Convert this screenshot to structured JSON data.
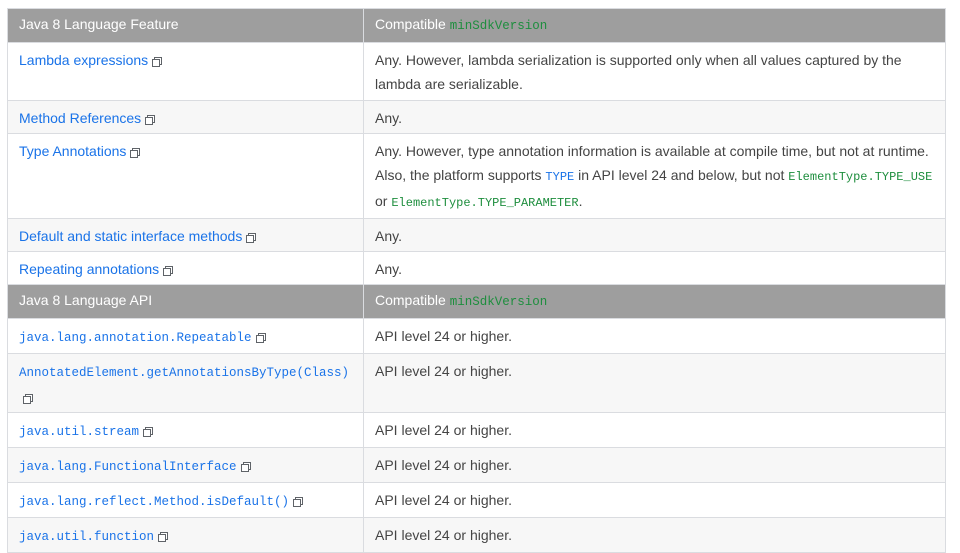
{
  "feature_table": {
    "header": {
      "col1": "Java 8 Language Feature",
      "col2_text": "Compatible ",
      "col2_code": "minSdkVersion"
    },
    "rows": [
      {
        "feature": "Lambda expressions",
        "desc": "Any. However, lambda serialization is supported only when all values captured by the lambda are serializable."
      },
      {
        "feature": "Method References",
        "desc": "Any."
      },
      {
        "feature": "Type Annotations",
        "desc_a": "Any. However, type annotation information is available at compile time, but not at runtime. Also, the platform supports ",
        "desc_code1": "TYPE",
        "desc_b": " in API level 24 and below, but not ",
        "desc_code2": "ElementType.TYPE_USE",
        "desc_c": " or ",
        "desc_code3": "ElementType.TYPE_PARAMETER",
        "desc_d": "."
      },
      {
        "feature": "Default and static interface methods",
        "desc": "Any."
      },
      {
        "feature": "Repeating annotations",
        "desc": "Any."
      }
    ]
  },
  "api_table": {
    "header": {
      "col1": "Java 8 Language API",
      "col2_text": "Compatible ",
      "col2_code": "minSdkVersion"
    },
    "rows": [
      {
        "api": "java.lang.annotation.Repeatable",
        "desc": "API level 24 or higher."
      },
      {
        "api": "AnnotatedElement.getAnnotationsByType(Class)",
        "desc": "API level 24 or higher."
      },
      {
        "api": "java.util.stream",
        "desc": "API level 24 or higher."
      },
      {
        "api": "java.lang.FunctionalInterface",
        "desc": "API level 24 or higher."
      },
      {
        "api": "java.lang.reflect.Method.isDefault()",
        "desc": "API level 24 or higher."
      },
      {
        "api": "java.util.function",
        "desc": "API level 24 or higher."
      }
    ]
  },
  "icons": {
    "external_link": "external-link-icon"
  },
  "colors": {
    "header_bg": "#9e9e9e",
    "link": "#1a73e8",
    "code_green": "#1e8e3e",
    "row_alt": "#f7f7f7"
  }
}
